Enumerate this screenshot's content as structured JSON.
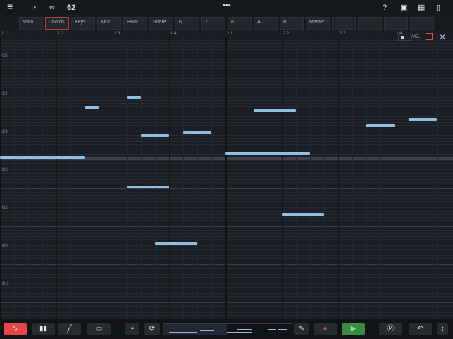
{
  "top_bar": {
    "tempo": "62",
    "icons": [
      "menu-icon",
      "metronome-icon",
      "loop-icon",
      "more-icon",
      "help-icon",
      "record-icon",
      "grid-icon",
      "battery-icon"
    ]
  },
  "tracks": {
    "items": [
      {
        "label": "Main"
      },
      {
        "label": "Chords"
      },
      {
        "label": "Keys"
      },
      {
        "label": "Kick"
      },
      {
        "label": "HHat"
      },
      {
        "label": "Snare"
      },
      {
        "label": "6"
      },
      {
        "label": "7"
      },
      {
        "label": "8"
      },
      {
        "label": "A"
      },
      {
        "label": "B"
      },
      {
        "label": "Master"
      }
    ]
  },
  "ruler": {
    "labels": [
      "1.1",
      "1.2",
      "1.3",
      "1.4",
      "2.1",
      "2.2",
      "2.3",
      "2.4"
    ]
  },
  "editor": {
    "velocity_label": "VEL",
    "octave_labels": [
      "C5",
      "C4",
      "C3",
      "C2",
      "C1",
      "C0",
      "C-1"
    ]
  },
  "notes": [
    {
      "start": 0.0,
      "len": 1.5,
      "pitch": "A2"
    },
    {
      "start": 1.5,
      "len": 0.25,
      "pitch": "F3"
    },
    {
      "start": 2.25,
      "len": 0.25,
      "pitch": "G3"
    },
    {
      "start": 2.5,
      "len": 0.5,
      "pitch": "F#2"
    },
    {
      "start": 2.25,
      "len": 0.75,
      "pitch": "D2"
    },
    {
      "start": 2.75,
      "len": 0.75,
      "pitch": "G0"
    },
    {
      "start": 3.25,
      "len": 0.5,
      "pitch": "C3"
    },
    {
      "start": 4.0,
      "len": 1.5,
      "pitch": "A2"
    },
    {
      "start": 4.5,
      "len": 0.75,
      "pitch": "D3"
    },
    {
      "start": 5.0,
      "len": 0.75,
      "pitch": "B1"
    },
    {
      "start": 6.5,
      "len": 0.5,
      "pitch": "A3"
    },
    {
      "start": 7.25,
      "len": 0.5,
      "pitch": "B3"
    }
  ],
  "bottom_bar": {
    "buttons": [
      "pattern-icon",
      "velocity-icon",
      "draw-icon",
      "select-icon",
      "paste-icon",
      "loop-icon",
      "edit-icon",
      "record-icon",
      "play-icon",
      "metronome-icon",
      "undo-icon",
      "expand-icon"
    ]
  }
}
